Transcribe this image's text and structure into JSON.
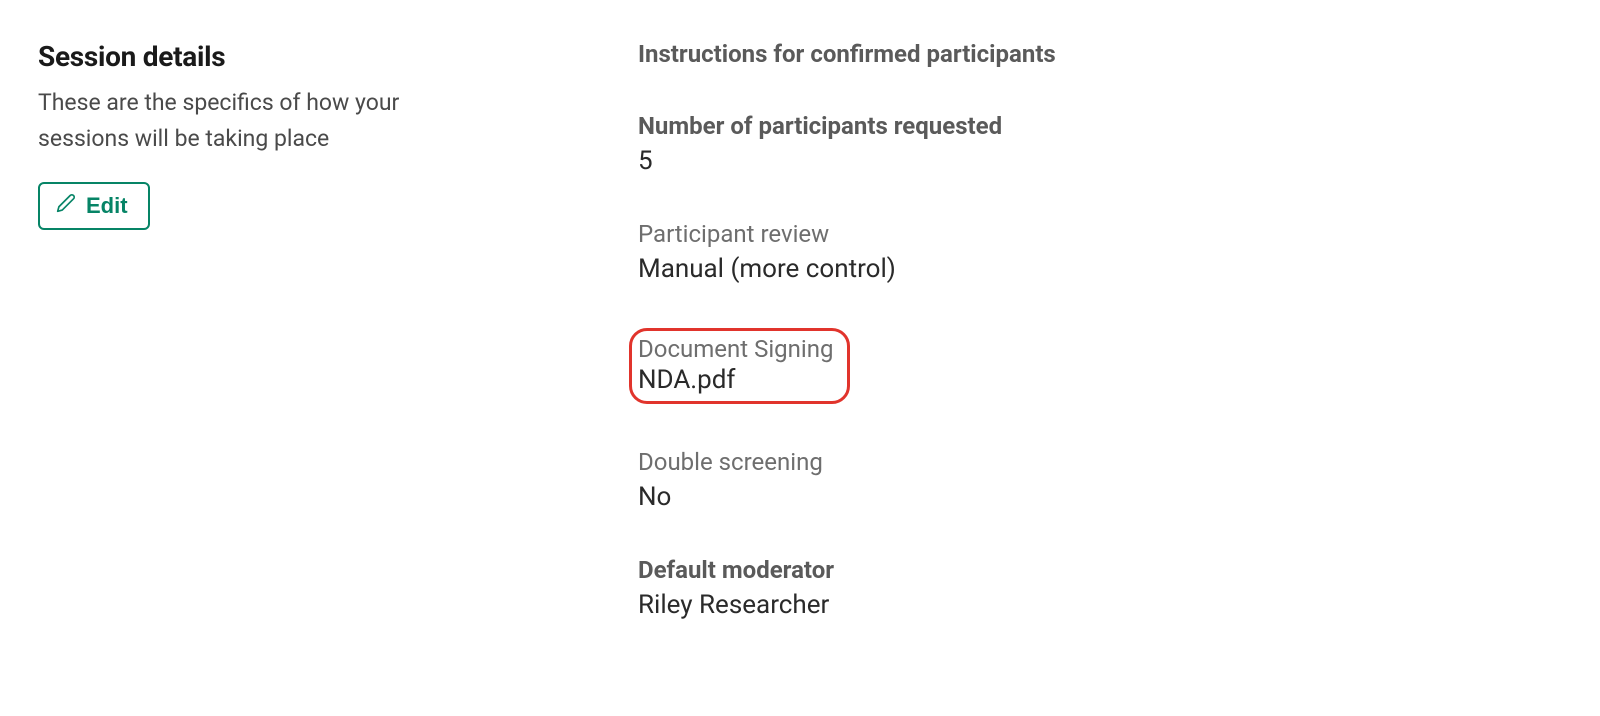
{
  "left": {
    "title": "Session details",
    "description": "These are the specifics of how your sessions will be taking place",
    "edit_label": "Edit"
  },
  "right": {
    "instructions_heading": "Instructions for confirmed participants",
    "participants_requested": {
      "label": "Number of participants requested",
      "value": "5"
    },
    "participant_review": {
      "label": "Participant review",
      "value": "Manual (more control)"
    },
    "document_signing": {
      "label": "Document Signing",
      "value": "NDA.pdf"
    },
    "double_screening": {
      "label": "Double screening",
      "value": "No"
    },
    "default_moderator": {
      "label": "Default moderator",
      "value": "Riley Researcher"
    }
  }
}
